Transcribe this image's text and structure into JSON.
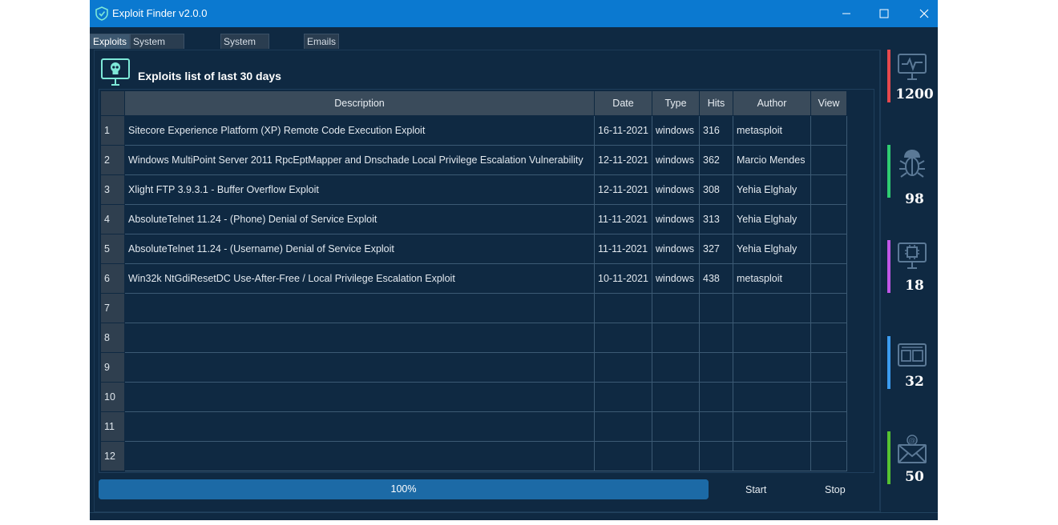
{
  "window": {
    "title": "Exploit Finder v2.0.0"
  },
  "tabs": [
    {
      "label": "Exploits",
      "active": true
    },
    {
      "label": "System Information",
      "active": false
    },
    {
      "label": "System Softwares",
      "active": false
    },
    {
      "label": "Emails",
      "active": false
    }
  ],
  "section": {
    "title": "Exploits list of last 30 days",
    "icon": "skull-monitor-icon"
  },
  "table": {
    "columns": [
      "Description",
      "Date",
      "Type",
      "Hits",
      "Author",
      "View"
    ],
    "rows": [
      {
        "num": "1",
        "description": "Sitecore Experience Platform (XP) Remote Code Execution Exploit",
        "date": "16-11-2021",
        "type": "windows",
        "hits": "316",
        "author": "metasploit",
        "view": ""
      },
      {
        "num": "2",
        "description": "Windows MultiPoint Server 2011 RpcEptMapper and Dnschade Local Privilege Escalation Vulnerability",
        "date": "12-11-2021",
        "type": "windows",
        "hits": "362",
        "author": "Marcio Mendes",
        "view": ""
      },
      {
        "num": "3",
        "description": "Xlight FTP 3.9.3.1 - Buffer Overflow Exploit",
        "date": "12-11-2021",
        "type": "windows",
        "hits": "308",
        "author": "Yehia Elghaly",
        "view": ""
      },
      {
        "num": "4",
        "description": "AbsoluteTelnet 11.24 - (Phone) Denial of Service Exploit",
        "date": "11-11-2021",
        "type": "windows",
        "hits": "313",
        "author": "Yehia Elghaly",
        "view": ""
      },
      {
        "num": "5",
        "description": "AbsoluteTelnet 11.24 - (Username) Denial of Service Exploit",
        "date": "11-11-2021",
        "type": "windows",
        "hits": "327",
        "author": "Yehia Elghaly",
        "view": ""
      },
      {
        "num": "6",
        "description": "Win32k NtGdiResetDC Use-After-Free / Local Privilege Escalation Exploit",
        "date": "10-11-2021",
        "type": "windows",
        "hits": "438",
        "author": "metasploit",
        "view": ""
      },
      {
        "num": "7",
        "description": "",
        "date": "",
        "type": "",
        "hits": "",
        "author": "",
        "view": ""
      },
      {
        "num": "8",
        "description": "",
        "date": "",
        "type": "",
        "hits": "",
        "author": "",
        "view": ""
      },
      {
        "num": "9",
        "description": "",
        "date": "",
        "type": "",
        "hits": "",
        "author": "",
        "view": ""
      },
      {
        "num": "10",
        "description": "",
        "date": "",
        "type": "",
        "hits": "",
        "author": "",
        "view": ""
      },
      {
        "num": "11",
        "description": "",
        "date": "",
        "type": "",
        "hits": "",
        "author": "",
        "view": ""
      },
      {
        "num": "12",
        "description": "",
        "date": "",
        "type": "",
        "hits": "",
        "author": "",
        "view": ""
      }
    ]
  },
  "progress": {
    "label": "100%",
    "value": 1.0
  },
  "buttons": {
    "start": "Start",
    "stop": "Stop"
  },
  "stats": [
    {
      "value": "1200",
      "icon": "monitor-pulse-icon",
      "color": "#e5484d"
    },
    {
      "value": "98",
      "icon": "bug-cloud-icon",
      "color": "#2ecc71"
    },
    {
      "value": "18",
      "icon": "cpu-monitor-icon",
      "color": "#c056e6"
    },
    {
      "value": "32",
      "icon": "window-panels-icon",
      "color": "#3b9cf0"
    },
    {
      "value": "50",
      "icon": "email-icon",
      "color": "#55c232"
    }
  ],
  "colors": {
    "titlebar": "#0b79d0",
    "background": "#0f2942",
    "progress": "#1c6aa6"
  }
}
